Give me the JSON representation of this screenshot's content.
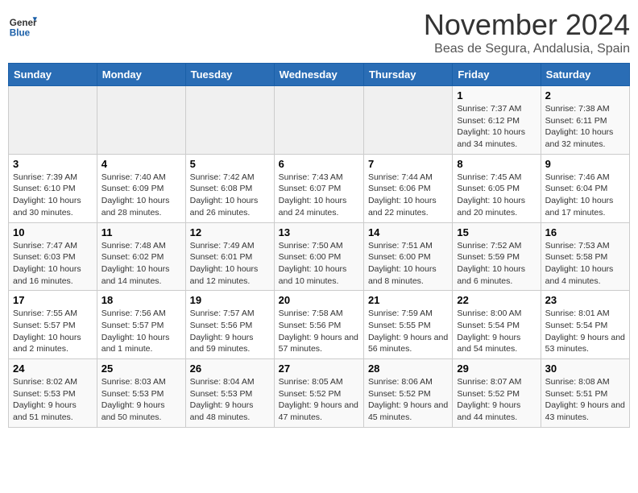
{
  "header": {
    "logo_general": "General",
    "logo_blue": "Blue",
    "month_title": "November 2024",
    "location": "Beas de Segura, Andalusia, Spain"
  },
  "days_of_week": [
    "Sunday",
    "Monday",
    "Tuesday",
    "Wednesday",
    "Thursday",
    "Friday",
    "Saturday"
  ],
  "weeks": [
    {
      "cells": [
        {
          "day": "",
          "empty": true
        },
        {
          "day": "",
          "empty": true
        },
        {
          "day": "",
          "empty": true
        },
        {
          "day": "",
          "empty": true
        },
        {
          "day": "",
          "empty": true
        },
        {
          "day": "1",
          "sunrise": "7:37 AM",
          "sunset": "6:12 PM",
          "daylight": "10 hours and 34 minutes."
        },
        {
          "day": "2",
          "sunrise": "7:38 AM",
          "sunset": "6:11 PM",
          "daylight": "10 hours and 32 minutes."
        }
      ]
    },
    {
      "cells": [
        {
          "day": "3",
          "sunrise": "7:39 AM",
          "sunset": "6:10 PM",
          "daylight": "10 hours and 30 minutes."
        },
        {
          "day": "4",
          "sunrise": "7:40 AM",
          "sunset": "6:09 PM",
          "daylight": "10 hours and 28 minutes."
        },
        {
          "day": "5",
          "sunrise": "7:42 AM",
          "sunset": "6:08 PM",
          "daylight": "10 hours and 26 minutes."
        },
        {
          "day": "6",
          "sunrise": "7:43 AM",
          "sunset": "6:07 PM",
          "daylight": "10 hours and 24 minutes."
        },
        {
          "day": "7",
          "sunrise": "7:44 AM",
          "sunset": "6:06 PM",
          "daylight": "10 hours and 22 minutes."
        },
        {
          "day": "8",
          "sunrise": "7:45 AM",
          "sunset": "6:05 PM",
          "daylight": "10 hours and 20 minutes."
        },
        {
          "day": "9",
          "sunrise": "7:46 AM",
          "sunset": "6:04 PM",
          "daylight": "10 hours and 17 minutes."
        }
      ]
    },
    {
      "cells": [
        {
          "day": "10",
          "sunrise": "7:47 AM",
          "sunset": "6:03 PM",
          "daylight": "10 hours and 16 minutes."
        },
        {
          "day": "11",
          "sunrise": "7:48 AM",
          "sunset": "6:02 PM",
          "daylight": "10 hours and 14 minutes."
        },
        {
          "day": "12",
          "sunrise": "7:49 AM",
          "sunset": "6:01 PM",
          "daylight": "10 hours and 12 minutes."
        },
        {
          "day": "13",
          "sunrise": "7:50 AM",
          "sunset": "6:00 PM",
          "daylight": "10 hours and 10 minutes."
        },
        {
          "day": "14",
          "sunrise": "7:51 AM",
          "sunset": "6:00 PM",
          "daylight": "10 hours and 8 minutes."
        },
        {
          "day": "15",
          "sunrise": "7:52 AM",
          "sunset": "5:59 PM",
          "daylight": "10 hours and 6 minutes."
        },
        {
          "day": "16",
          "sunrise": "7:53 AM",
          "sunset": "5:58 PM",
          "daylight": "10 hours and 4 minutes."
        }
      ]
    },
    {
      "cells": [
        {
          "day": "17",
          "sunrise": "7:55 AM",
          "sunset": "5:57 PM",
          "daylight": "10 hours and 2 minutes."
        },
        {
          "day": "18",
          "sunrise": "7:56 AM",
          "sunset": "5:57 PM",
          "daylight": "10 hours and 1 minute."
        },
        {
          "day": "19",
          "sunrise": "7:57 AM",
          "sunset": "5:56 PM",
          "daylight": "9 hours and 59 minutes."
        },
        {
          "day": "20",
          "sunrise": "7:58 AM",
          "sunset": "5:56 PM",
          "daylight": "9 hours and 57 minutes."
        },
        {
          "day": "21",
          "sunrise": "7:59 AM",
          "sunset": "5:55 PM",
          "daylight": "9 hours and 56 minutes."
        },
        {
          "day": "22",
          "sunrise": "8:00 AM",
          "sunset": "5:54 PM",
          "daylight": "9 hours and 54 minutes."
        },
        {
          "day": "23",
          "sunrise": "8:01 AM",
          "sunset": "5:54 PM",
          "daylight": "9 hours and 53 minutes."
        }
      ]
    },
    {
      "cells": [
        {
          "day": "24",
          "sunrise": "8:02 AM",
          "sunset": "5:53 PM",
          "daylight": "9 hours and 51 minutes."
        },
        {
          "day": "25",
          "sunrise": "8:03 AM",
          "sunset": "5:53 PM",
          "daylight": "9 hours and 50 minutes."
        },
        {
          "day": "26",
          "sunrise": "8:04 AM",
          "sunset": "5:53 PM",
          "daylight": "9 hours and 48 minutes."
        },
        {
          "day": "27",
          "sunrise": "8:05 AM",
          "sunset": "5:52 PM",
          "daylight": "9 hours and 47 minutes."
        },
        {
          "day": "28",
          "sunrise": "8:06 AM",
          "sunset": "5:52 PM",
          "daylight": "9 hours and 45 minutes."
        },
        {
          "day": "29",
          "sunrise": "8:07 AM",
          "sunset": "5:52 PM",
          "daylight": "9 hours and 44 minutes."
        },
        {
          "day": "30",
          "sunrise": "8:08 AM",
          "sunset": "5:51 PM",
          "daylight": "9 hours and 43 minutes."
        }
      ]
    }
  ]
}
